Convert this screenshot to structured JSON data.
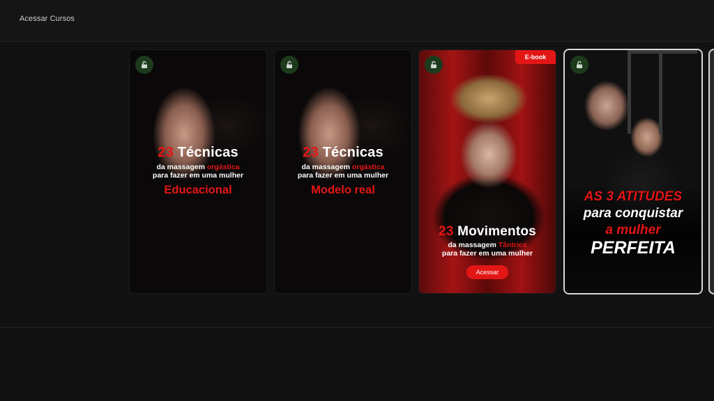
{
  "topbar": {
    "title": "Acessar Cursos"
  },
  "colors": {
    "accent": "#e31616",
    "background": "#111111",
    "lock_bg": "#1d3a1d"
  },
  "cards": [
    {
      "icon": "unlock-icon",
      "number": "23",
      "headline": "Técnicas",
      "sub_prefix": "da massagem ",
      "sub_highlight": "orgástica",
      "sub_line2": "para fazer em uma mulher",
      "tag": "Educacional"
    },
    {
      "icon": "unlock-icon",
      "number": "23",
      "headline": "Técnicas",
      "sub_prefix": "da massagem ",
      "sub_highlight": "orgástica",
      "sub_line2": "para fazer em uma mulher",
      "tag": "Modelo real"
    },
    {
      "icon": "unlock-icon",
      "badge": "E-book",
      "number": "23",
      "headline": "Movimentos",
      "sub_prefix": "da massagem ",
      "sub_highlight": "Tântrica",
      "sub_line2": "para fazer em uma mulher",
      "button": "Acessar"
    },
    {
      "icon": "unlock-icon",
      "line1": "AS 3 ATITUDES",
      "line2": "para conquistar",
      "line3": "a mulher",
      "line4": "PERFEITA"
    }
  ]
}
